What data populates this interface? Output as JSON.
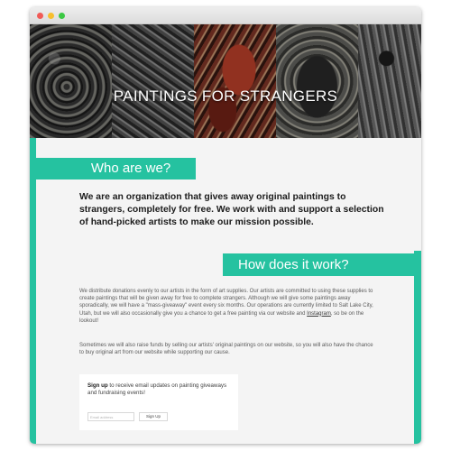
{
  "hero": {
    "title": "PAINTINGS FOR STRANGERS"
  },
  "about": {
    "heading": "Who are we?",
    "lead": "We are an organization that gives away original paintings to strangers, completely for free. We work with and support a selection of hand-picked artists to make our mission possible."
  },
  "how": {
    "heading": "How does it work?",
    "paragraph1_before_link": "We distribute donations evenly to our artists in the form of art supplies. Our artists are committed to using these supplies to create paintings that will be given away for free to complete strangers. Although we will give some paintings away sporadically, we will have a \"mass-giveaway\" event every six months. Our operations are currently limited to Salt Lake City, Utah, but we will also occasionally give you a chance to get a free painting via our website and ",
    "paragraph1_link": "Instagram",
    "paragraph1_after_link": ", so be on the lookout!",
    "paragraph2": "Sometimes we will also raise funds by selling our artists' original paintings on our website, so you will also have the chance to buy original art from our website while supporting our cause."
  },
  "signup": {
    "bold": "Sign up",
    "text": " to receive email updates on painting giveaways and fundraising events!",
    "email_placeholder": "Email address",
    "email_value": "",
    "button_label": "Sign Up"
  },
  "colors": {
    "accent": "#25c2a0"
  }
}
